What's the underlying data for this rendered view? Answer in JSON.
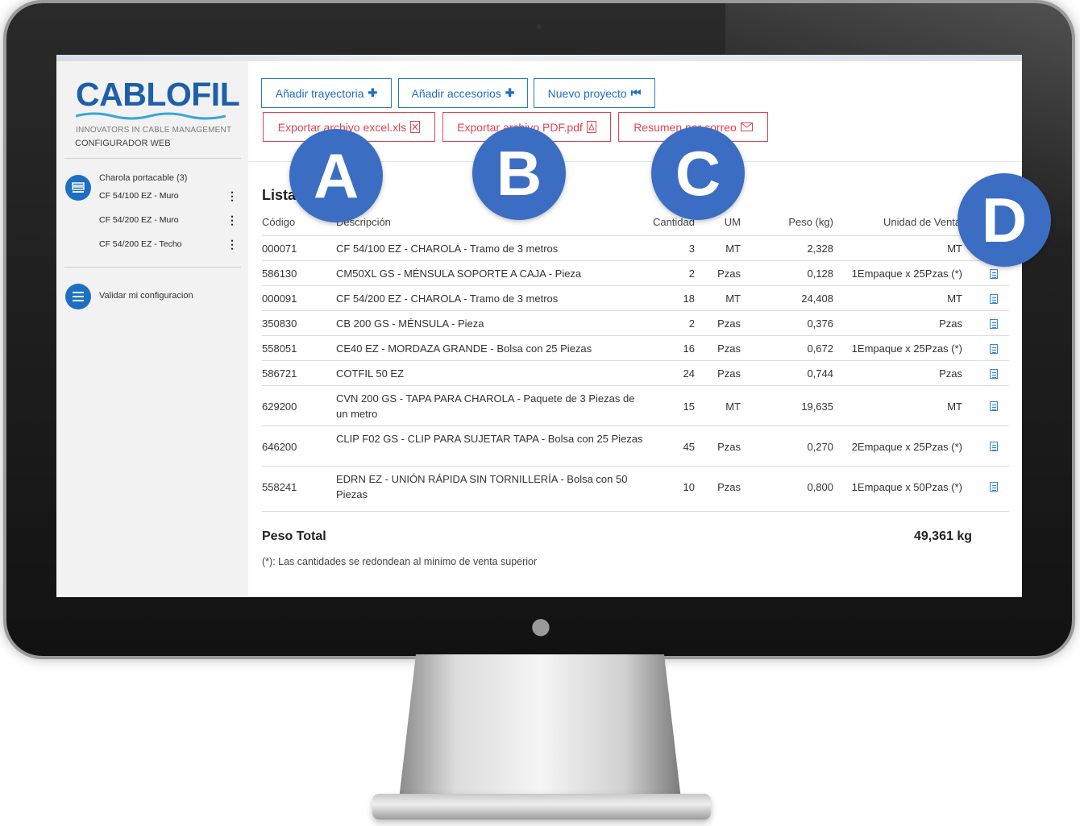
{
  "sidebar": {
    "logo": "CABLOFIL",
    "tagline": "INNOVATORS IN CABLE MANAGEMENT",
    "subtitle": "CONFIGURADOR WEB",
    "group_title": "Charola portacable (3)",
    "items": [
      "CF 54/100 EZ - Muro",
      "CF 54/200 EZ - Muro",
      "CF 54/200 EZ - Techo"
    ],
    "validate_label": "Validar mi configuracion",
    "menu_glyph": "⋮"
  },
  "toolbar": {
    "add_path": "Añadir trayectoria",
    "add_accessories": "Añadir accesorios",
    "new_project": "Nuevo proyecto",
    "export_excel": "Exportar archivo excel.xls",
    "export_pdf": "Exportar archivo PDF.pdf",
    "email_summary": "Resumen por correo"
  },
  "list": {
    "title": "Lista de piezas",
    "columns": [
      "Código",
      "Descripción",
      "Cantidad",
      "UM",
      "Peso (kg)",
      "Unidad de Venta"
    ],
    "rows": [
      {
        "code": "000071",
        "desc": "CF 54/100 EZ - CHAROLA - Tramo de 3 metros",
        "qty": "3",
        "um": "MT",
        "weight": "2,328",
        "unit": "MT"
      },
      {
        "code": "586130",
        "desc": "CM50XL GS - MÉNSULA SOPORTE A CAJA - Pieza",
        "qty": "2",
        "um": "Pzas",
        "weight": "0,128",
        "unit": "1Empaque x 25Pzas (*)"
      },
      {
        "code": "000091",
        "desc": "CF 54/200 EZ - CHAROLA - Tramo de 3 metros",
        "qty": "18",
        "um": "MT",
        "weight": "24,408",
        "unit": "MT"
      },
      {
        "code": "350830",
        "desc": "CB 200 GS - MÉNSULA - Pieza",
        "qty": "2",
        "um": "Pzas",
        "weight": "0,376",
        "unit": "Pzas"
      },
      {
        "code": "558051",
        "desc": "CE40 EZ - MORDAZA GRANDE - Bolsa con 25 Piezas",
        "qty": "16",
        "um": "Pzas",
        "weight": "0,672",
        "unit": "1Empaque x 25Pzas (*)"
      },
      {
        "code": "586721",
        "desc": "COTFIL 50 EZ",
        "qty": "24",
        "um": "Pzas",
        "weight": "0,744",
        "unit": "Pzas"
      },
      {
        "code": "629200",
        "desc": "CVN 200 GS - TAPA PARA CHAROLA - Paquete de 3 Piezas de un metro",
        "qty": "15",
        "um": "MT",
        "weight": "19,635",
        "unit": "MT"
      },
      {
        "code": "646200",
        "desc": "CLIP F02 GS - CLIP PARA SUJETAR TAPA - Bolsa con 25 Piezas",
        "qty": "45",
        "um": "Pzas",
        "weight": "0,270",
        "unit": "2Empaque x 25Pzas (*)"
      },
      {
        "code": "558241",
        "desc": "EDRN EZ - UNIÓN RÁPIDA SIN TORNILLERÍA - Bolsa con 50 Piezas",
        "qty": "10",
        "um": "Pzas",
        "weight": "0,800",
        "unit": "1Empaque x 50Pzas (*)"
      }
    ],
    "total_label": "Peso Total",
    "total_value": "49,361 kg",
    "footnote": "(*): Las cantidades se redondean al minimo de venta superior"
  },
  "callouts": [
    "A",
    "B",
    "C",
    "D"
  ],
  "colors": {
    "accent_blue": "#1e6fbc",
    "export_red": "#e0434f",
    "callout": "#3b6ec3"
  }
}
